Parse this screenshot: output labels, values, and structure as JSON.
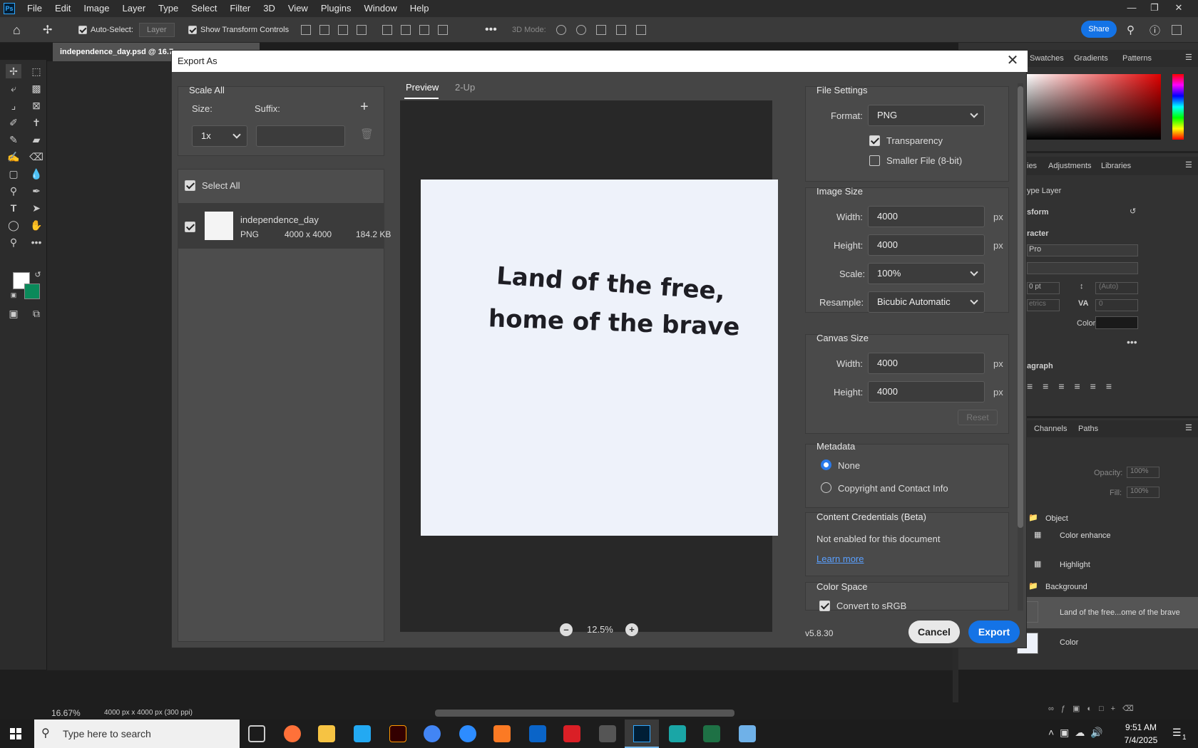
{
  "menubar": {
    "items": [
      "File",
      "Edit",
      "Image",
      "Layer",
      "Type",
      "Select",
      "Filter",
      "3D",
      "View",
      "Plugins",
      "Window",
      "Help"
    ]
  },
  "options": {
    "auto_select": "Auto-Select:",
    "layer_dropdown": "Layer",
    "show_transform": "Show Transform Controls",
    "mode_3d": "3D Mode:",
    "share": "Share"
  },
  "document": {
    "tab_title": "independence_day.psd @ 16.7",
    "zoom": "16.67%",
    "doc_info": "4000 px x 4000 px (300 ppi)"
  },
  "right_panel": {
    "top_tabs": [
      "Swatches",
      "Gradients",
      "Patterns"
    ],
    "mid_tabs": [
      "ies",
      "Adjustments",
      "Libraries"
    ],
    "type_layer": "ype Layer",
    "transform": "sform",
    "character": "racter",
    "font": "Pro",
    "auto": "(Auto)",
    "pt": "0 pt",
    "metrics": "etrics",
    "tracking": "0",
    "color_label": "Color",
    "paragraph": "agraph",
    "layer_tabs": [
      "Channels",
      "Paths"
    ],
    "opacity_label": "Opacity:",
    "opacity_val": "100%",
    "fill_label": "Fill:",
    "fill_val": "100%",
    "layers": [
      "Object",
      "Color enhance",
      "Highlight",
      "Background",
      "Land of the free...ome of the brave",
      "Color"
    ]
  },
  "dialog": {
    "title": "Export As",
    "scale_all": "Scale All",
    "size_label": "Size:",
    "suffix_label": "Suffix:",
    "size_value": "1x",
    "select_all": "Select All",
    "item": {
      "name": "independence_day",
      "format": "PNG",
      "dims": "4000 x 4000",
      "size": "184.2 KB"
    },
    "tabs": [
      "Preview",
      "2-Up"
    ],
    "artboard_text": [
      "Land of the free,",
      "home of the brave"
    ],
    "zoom": "12.5%",
    "version": "v5.8.30",
    "file_settings": {
      "title": "File Settings",
      "format_label": "Format:",
      "format_value": "PNG",
      "transparency": "Transparency",
      "smaller_file": "Smaller File (8-bit)"
    },
    "image_size": {
      "title": "Image Size",
      "width_label": "Width:",
      "width": "4000",
      "height_label": "Height:",
      "height": "4000",
      "scale_label": "Scale:",
      "scale": "100%",
      "resample_label": "Resample:",
      "resample": "Bicubic Automatic",
      "unit": "px"
    },
    "canvas_size": {
      "title": "Canvas Size",
      "width_label": "Width:",
      "width": "4000",
      "height_label": "Height:",
      "height": "4000",
      "reset": "Reset",
      "unit": "px"
    },
    "metadata": {
      "title": "Metadata",
      "none": "None",
      "copyright": "Copyright and Contact Info"
    },
    "credentials": {
      "title": "Content Credentials (Beta)",
      "status": "Not enabled for this document",
      "learn_more": "Learn more"
    },
    "color_space": {
      "title": "Color Space",
      "convert": "Convert to sRGB"
    },
    "cancel": "Cancel",
    "export": "Export"
  },
  "taskbar": {
    "search": "Type here to search",
    "time": "9:51 AM",
    "date": "7/4/2025",
    "notif": "1"
  }
}
